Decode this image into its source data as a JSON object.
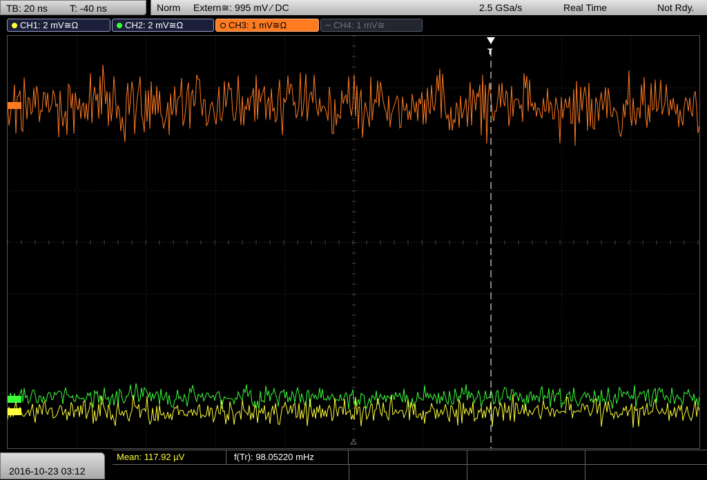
{
  "timebase": {
    "tb_label": "TB: 20 ns",
    "trigger_time": "T: -40 ns"
  },
  "trigger": {
    "mode": "Norm",
    "source_level": "Extern≅: 995 mV ⁄ DC",
    "sample_rate": "2.5 GSa/s",
    "acq_mode": "Real Time",
    "status": "Not Rdy."
  },
  "channels": [
    {
      "label": "CH1: 2 mV≅Ω",
      "color": "#ffff3a",
      "active": true
    },
    {
      "label": "CH2: 2 mV≅Ω",
      "color": "#39ff3a",
      "active": true
    },
    {
      "label": "CH3: 1 mV≅Ω",
      "color": "#ff7b22",
      "active": true,
      "selected": true
    },
    {
      "label": "CH4: 1 mV≅",
      "color": "#555a66",
      "active": false
    }
  ],
  "markers": {
    "trigger_marker": "T"
  },
  "measurements": {
    "mean": "Mean: 117.92 µV",
    "freq": "f(Tr): 98.05220 mHz"
  },
  "footer": {
    "datetime": "2016-10-23 03:12"
  },
  "colors": {
    "ch1": "#ffff3a",
    "ch2": "#39ff3a",
    "ch3": "#ff7b22",
    "grid": "#3a3a3a"
  }
}
